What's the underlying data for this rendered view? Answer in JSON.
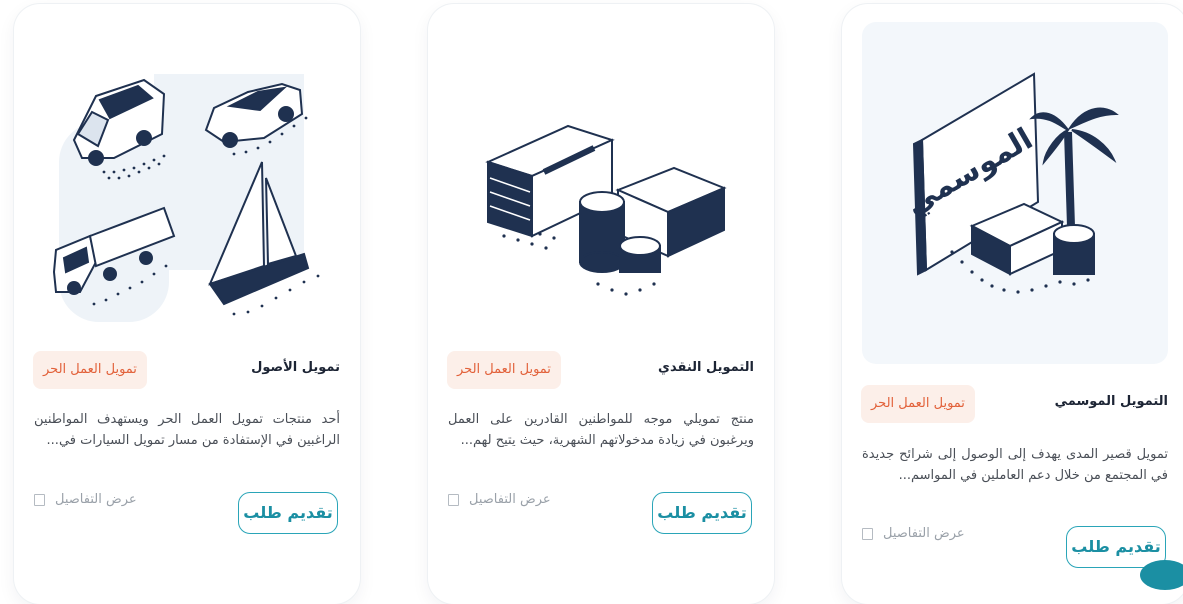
{
  "cards": [
    {
      "title": "تمويل الأصول",
      "badge": "تمويل العمل الحر",
      "description": "أحد منتجات تمويل العمل الحر ويستهدف المواطنين الراغبين في الإستفادة من مسار تمويل السيارات في...",
      "details_label": "عرض التفاصيل",
      "apply_label": "تقديم طلب",
      "icon": "vehicles-illustration"
    },
    {
      "title": "التمويل النقدي",
      "badge": "تمويل العمل الحر",
      "description": "منتج تمويلي موجه للمواطنين القادرين على العمل ويرغبون في زيادة مدخولاتهم الشهرية، حيث يتيح لهم...",
      "details_label": "عرض التفاصيل",
      "apply_label": "تقديم طلب",
      "icon": "cash-money-illustration"
    },
    {
      "title": "التمويل الموسمي",
      "badge": "تمويل العمل الحر",
      "description": "تمويل قصير المدى يهدف إلى الوصول إلى شرائح جديدة في المجتمع من خلال دعم العاملين في المواسم...",
      "details_label": "عرض التفاصيل",
      "apply_label": "تقديم طلب",
      "icon": "seasonal-illustration",
      "illustration_text": "الموسمي"
    }
  ],
  "colors": {
    "badge_bg": "#fcefe9",
    "badge_text": "#e2613a",
    "apply_border": "#2aa5b8",
    "apply_text": "#1b8fa3",
    "illus_ink": "#1f3150",
    "illus_panel": "#f3f7fb"
  }
}
